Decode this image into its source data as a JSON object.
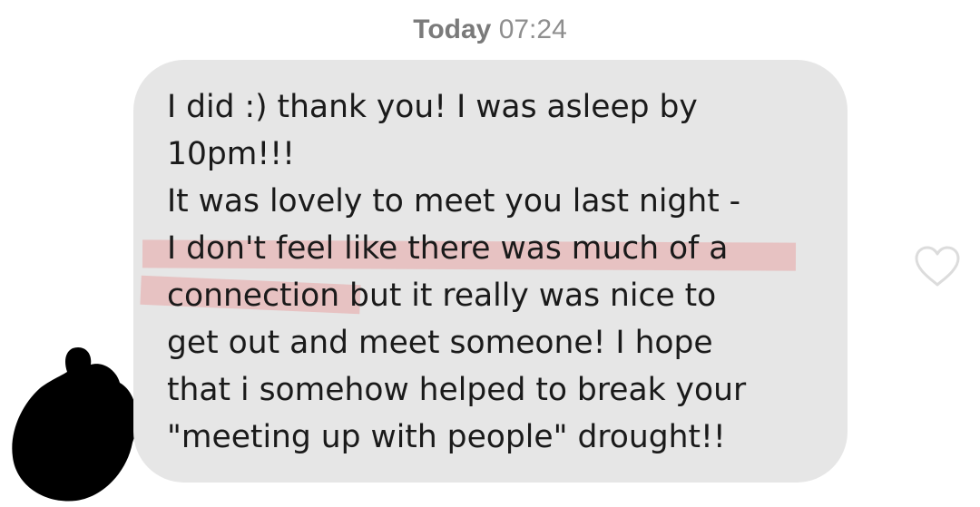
{
  "header": {
    "day_label": "Today",
    "time_label": "07:24"
  },
  "message": {
    "lines": [
      "I did :) thank you! I was asleep by",
      "10pm!!!",
      "It was lovely to meet you last night -",
      "I don't feel like there was much of a",
      "connection but it really was nice to",
      "get out and meet someone! I hope",
      "that i somehow helped to break your",
      "\"meeting up with people\" drought!!"
    ],
    "bubble_color": "#e6e6e6",
    "highlight_color": "#e89696"
  },
  "actions": {
    "like_icon": "heart-outline-icon"
  },
  "sender": {
    "avatar": "redacted-avatar"
  }
}
